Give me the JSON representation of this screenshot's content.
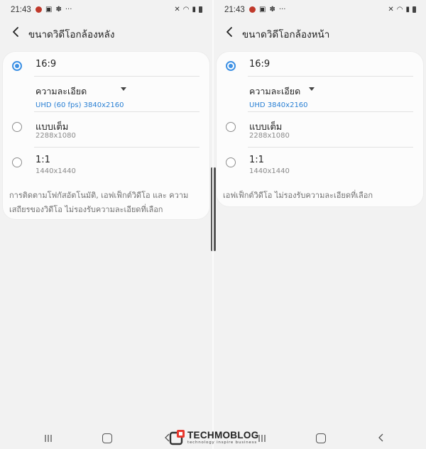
{
  "status": {
    "time": "21:43",
    "dots": "···"
  },
  "left": {
    "title": "ขนาดวิดีโอกล้องหลัง",
    "options": [
      {
        "label": "16:9",
        "selected": true
      },
      {
        "label": "แบบเต็ม",
        "sub": "2288x1080"
      },
      {
        "label": "1:1",
        "sub": "1440x1440"
      }
    ],
    "resolution": {
      "label": "ความละเอียด",
      "value": "UHD (60 fps) 3840x2160"
    },
    "note": "การติดตามโฟกัสอัตโนมัติ, เอฟเฟ็กต์วิดีโอ และ ความเสถียรของวิดีโอ ไม่รองรับความละเอียดที่เลือก"
  },
  "right": {
    "title": "ขนาดวิดีโอกล้องหน้า",
    "options": [
      {
        "label": "16:9",
        "selected": true
      },
      {
        "label": "แบบเต็ม",
        "sub": "2288x1080"
      },
      {
        "label": "1:1",
        "sub": "1440x1440"
      }
    ],
    "resolution": {
      "label": "ความละเอียด",
      "value": "UHD 3840x2160"
    },
    "note": "เอฟเฟ็กต์วิดีโอ ไม่รองรับความละเอียดที่เลือก"
  },
  "watermark": {
    "brand": "TECHMOBLOG",
    "tagline": "technology inspire business"
  },
  "colors": {
    "accent": "#3e91e4",
    "link": "#2a80d4",
    "background": "#f2f2f2",
    "card": "#fcfcfc"
  }
}
